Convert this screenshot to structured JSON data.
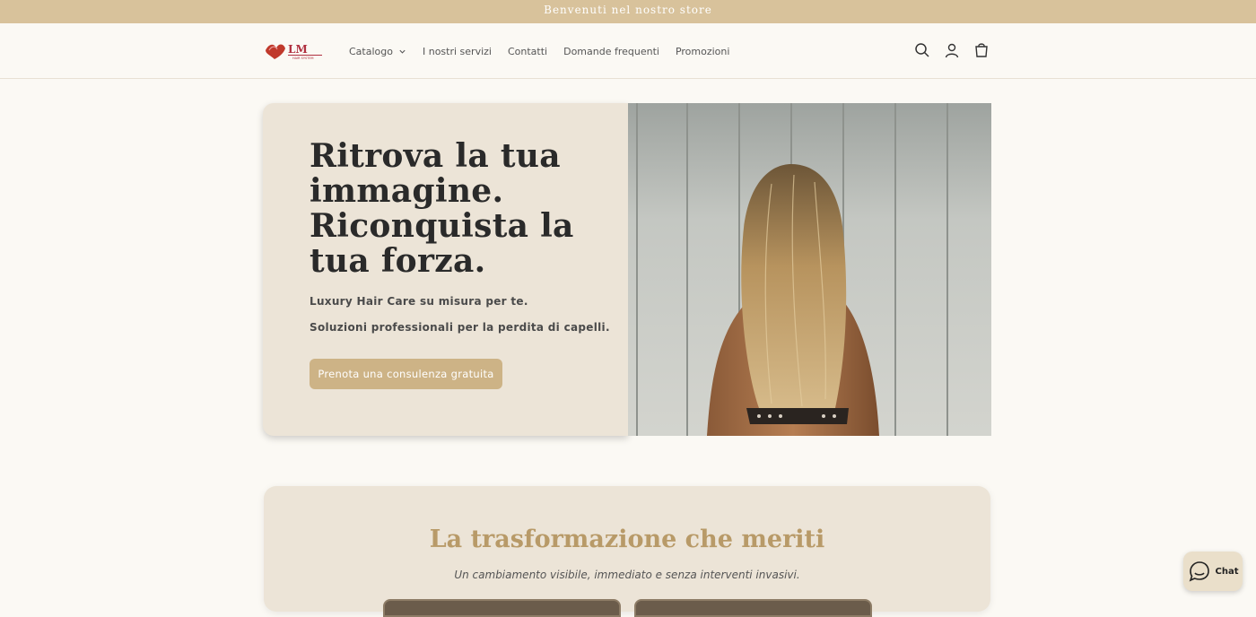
{
  "announcement": "Benvenuti nel nostro store",
  "header": {
    "logo_text": "LM Hair System",
    "nav": [
      {
        "label": "Catalogo"
      },
      {
        "label": "I nostri servizi"
      },
      {
        "label": "Contatti"
      },
      {
        "label": "Domande frequenti"
      },
      {
        "label": "Promozioni"
      }
    ],
    "icons": [
      "search-icon",
      "account-icon",
      "cart-icon"
    ]
  },
  "hero": {
    "title": "Ritrova la tua immagine. Riconquista la tua forza.",
    "subtitle_1": "Luxury Hair Care su misura per te.",
    "subtitle_2": "Soluzioni professionali per la perdita di capelli.",
    "cta": "Prenota una consulenza gratuita"
  },
  "transformation": {
    "title": "La trasformazione che meriti",
    "subtitle": "Un cambiamento visibile, immediato e senza interventi invasivi."
  },
  "chat": {
    "label": "Chat"
  },
  "colors": {
    "announcement_bg": "#d8c29b",
    "accent": "#cdb386",
    "panel": "#ece4d7",
    "title_gold": "#b89a68"
  }
}
